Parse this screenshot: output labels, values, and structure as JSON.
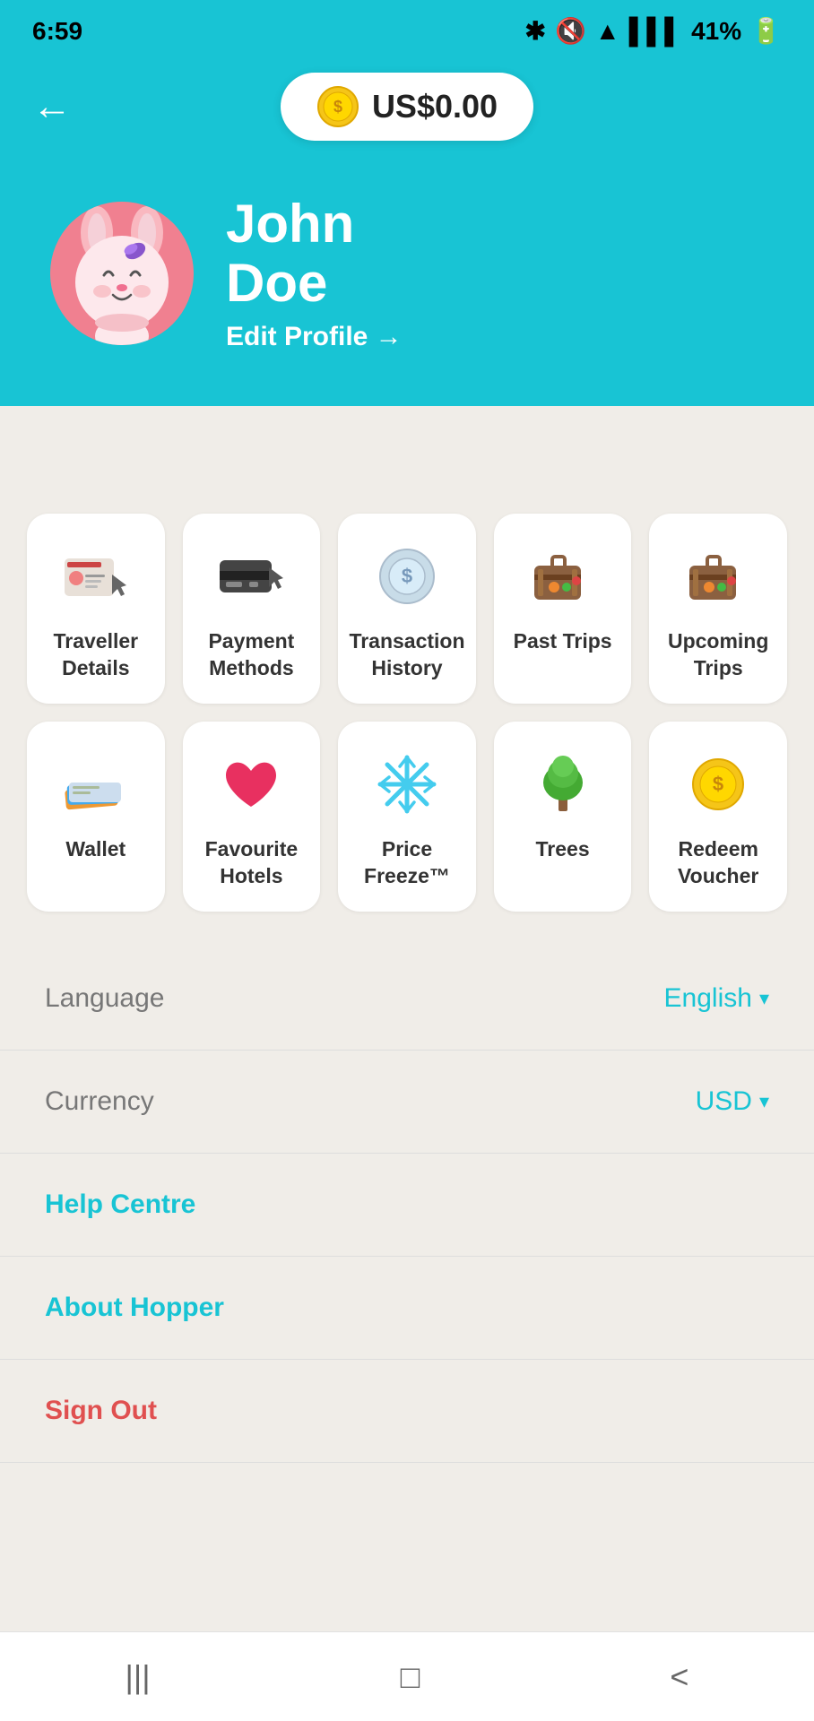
{
  "status_bar": {
    "time": "6:59",
    "battery": "41%"
  },
  "header": {
    "balance": "US$0.00",
    "back_label": "←"
  },
  "profile": {
    "name_line1": "John",
    "name_line2": "Doe",
    "edit_label": "Edit Profile →"
  },
  "grid": {
    "items": [
      {
        "id": "traveller-details",
        "label": "Traveller Details",
        "icon": "traveller"
      },
      {
        "id": "payment-methods",
        "label": "Payment Methods",
        "icon": "payment"
      },
      {
        "id": "transaction-history",
        "label": "Transaction History",
        "icon": "transaction"
      },
      {
        "id": "past-trips",
        "label": "Past Trips",
        "icon": "past-trips"
      },
      {
        "id": "upcoming-trips",
        "label": "Upcoming Trips",
        "icon": "upcoming-trips"
      },
      {
        "id": "wallet",
        "label": "Wallet",
        "icon": "wallet"
      },
      {
        "id": "favourite-hotels",
        "label": "Favourite Hotels",
        "icon": "favourite"
      },
      {
        "id": "price-freeze",
        "label": "Price Freeze™",
        "icon": "price-freeze"
      },
      {
        "id": "trees",
        "label": "Trees",
        "icon": "trees"
      },
      {
        "id": "redeem-voucher",
        "label": "Redeem Voucher",
        "icon": "voucher"
      }
    ]
  },
  "settings": {
    "language_label": "Language",
    "language_value": "English",
    "currency_label": "Currency",
    "currency_value": "USD",
    "help_centre": "Help Centre",
    "about_hopper": "About Hopper",
    "sign_out": "Sign Out"
  },
  "bottom_nav": {
    "menu_icon": "|||",
    "home_icon": "□",
    "back_icon": "<"
  }
}
